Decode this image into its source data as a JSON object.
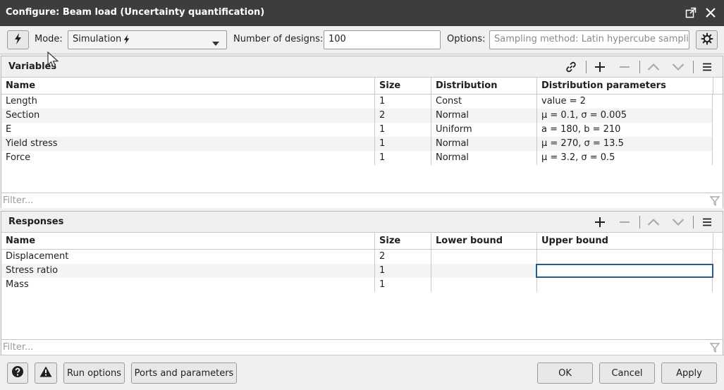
{
  "window": {
    "title": "Configure: Beam load (Uncertainty quantification)"
  },
  "toolbar": {
    "mode_label": "Mode:",
    "mode_value": "Simulation",
    "designs_label": "Number of designs:",
    "designs_value": "100",
    "options_label": "Options:",
    "options_placeholder": "Sampling method: Latin hypercube sampling"
  },
  "variables": {
    "title": "Variables",
    "columns": [
      "Name",
      "Size",
      "Distribution",
      "Distribution parameters"
    ],
    "rows": [
      [
        "Length",
        "1",
        "Const",
        "value = 2"
      ],
      [
        "Section",
        "2",
        "Normal",
        "μ = 0.1, σ = 0.005"
      ],
      [
        "E",
        "1",
        "Uniform",
        "a = 180, b = 210"
      ],
      [
        "Yield stress",
        "1",
        "Normal",
        "μ = 270, σ = 13.5"
      ],
      [
        "Force",
        "1",
        "Normal",
        "μ = 3.2, σ = 0.5"
      ]
    ],
    "filter_placeholder": "Filter..."
  },
  "responses": {
    "title": "Responses",
    "columns": [
      "Name",
      "Size",
      "Lower bound",
      "Upper bound"
    ],
    "rows": [
      [
        "Displacement",
        "2",
        "",
        ""
      ],
      [
        "Stress ratio",
        "1",
        "",
        ""
      ],
      [
        "Mass",
        "1",
        "",
        ""
      ]
    ],
    "filter_placeholder": "Filter..."
  },
  "footer": {
    "run_options": "Run options",
    "ports_params": "Ports and parameters",
    "ok": "OK",
    "cancel": "Cancel",
    "apply": "Apply"
  }
}
